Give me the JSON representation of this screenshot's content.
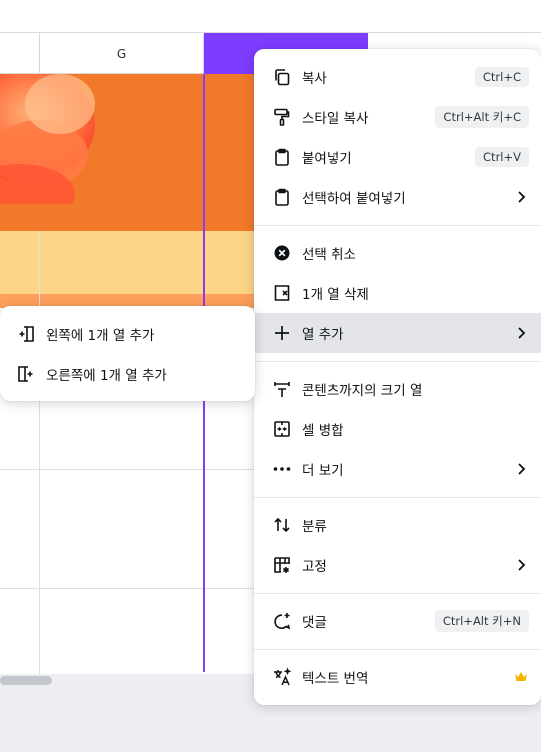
{
  "columns": {
    "g": "G",
    "h": ""
  },
  "menu": {
    "items": [
      {
        "id": "copy",
        "label": "복사",
        "shortcut": "Ctrl+C",
        "icon": "copy-icon"
      },
      {
        "id": "copy-style",
        "label": "스타일 복사",
        "shortcut": "Ctrl+Alt 키+C",
        "icon": "paint-roller-icon"
      },
      {
        "id": "paste",
        "label": "붙여넣기",
        "shortcut": "Ctrl+V",
        "icon": "clipboard-icon"
      },
      {
        "id": "paste-special",
        "label": "선택하여 붙여넣기",
        "icon": "clipboard-icon",
        "submenu": true
      },
      {
        "id": "deselect",
        "label": "선택 취소",
        "icon": "close-circle-icon"
      },
      {
        "id": "delete-column",
        "label": "1개 열 삭제",
        "icon": "delete-column-icon"
      },
      {
        "id": "add-column",
        "label": "열 추가",
        "icon": "plus-icon",
        "submenu": true,
        "active": true
      },
      {
        "id": "fit-column",
        "label": "콘텐츠까지의 크기 열",
        "icon": "fit-width-icon"
      },
      {
        "id": "merge-cells",
        "label": "셀 병합",
        "icon": "merge-cells-icon"
      },
      {
        "id": "more",
        "label": "더 보기",
        "icon": "more-horizontal-icon",
        "submenu": true
      },
      {
        "id": "sort",
        "label": "분류",
        "icon": "sort-icon"
      },
      {
        "id": "freeze",
        "label": "고정",
        "icon": "freeze-icon",
        "submenu": true
      },
      {
        "id": "comment",
        "label": "댓글",
        "shortcut": "Ctrl+Alt 키+N",
        "icon": "comment-add-icon"
      },
      {
        "id": "translate",
        "label": "텍스트 번역",
        "icon": "translate-icon",
        "badge": "crown-icon"
      }
    ]
  },
  "submenu": {
    "items": [
      {
        "id": "add-left",
        "label": "왼쪽에 1개 열 추가",
        "icon": "insert-column-left-icon"
      },
      {
        "id": "add-right",
        "label": "오른쪽에 1개 열 추가",
        "icon": "insert-column-right-icon"
      }
    ]
  },
  "colors": {
    "selection": "#7d3cff",
    "orange_band": "#f2792a",
    "yellow_band": "#fdd587",
    "crown": "#f5b400"
  }
}
